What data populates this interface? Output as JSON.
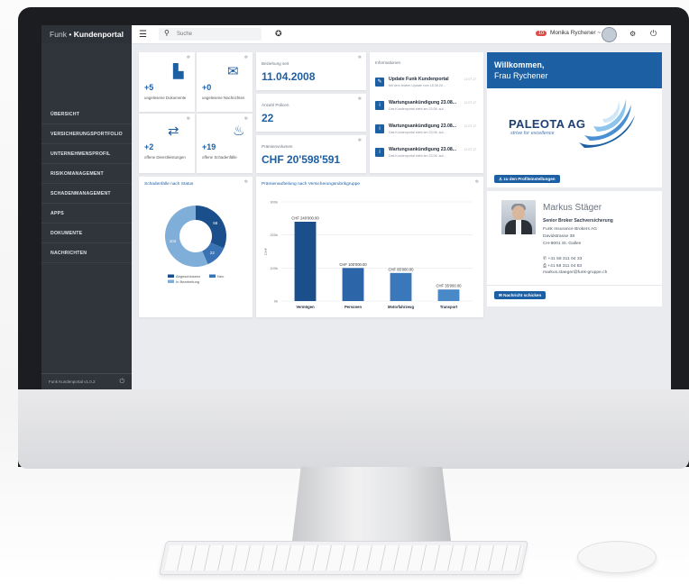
{
  "topbar": {
    "brand_thin": "Funk",
    "brand_sep": "•",
    "brand_bold": "Kundenportal",
    "search_placeholder": "Suche",
    "user_badge": "10",
    "user_name": "Monika Rychener ~"
  },
  "sidebar": {
    "items": [
      {
        "label": "ÜBERSICHT"
      },
      {
        "label": "VERSICHERUNGSPORTFOLIO"
      },
      {
        "label": "UNTERNEHMENSPROFIL"
      },
      {
        "label": "RISIKOMANAGEMENT"
      },
      {
        "label": "SCHADENMANAGEMENT"
      },
      {
        "label": "APPS"
      },
      {
        "label": "DOKUMENTE"
      },
      {
        "label": "NACHRICHTEN"
      }
    ],
    "footer": "Funk Kundenportal v1.0.2"
  },
  "tiles": [
    {
      "value": "+5",
      "label": "ungelesene Dokumente",
      "icon": "document-icon"
    },
    {
      "value": "+0",
      "label": "ungelesene Nachrichten",
      "icon": "envelope-icon"
    },
    {
      "value": "+2",
      "label": "offene Dienstleistungen",
      "icon": "repeat-icon"
    },
    {
      "value": "+19",
      "label": "offene Schadenfälle",
      "icon": "fire-icon"
    }
  ],
  "stats": {
    "relationship_label": "Beziehung seit",
    "relationship_value": "11.04.2008",
    "policies_label": "Anzahl Policen",
    "policies_value": "22",
    "premium_label": "Prämienvolumen",
    "premium_value": "CHF 20'598'591"
  },
  "info": {
    "title": "Informationen",
    "items": [
      {
        "title": "Update Funk Kundenportal",
        "sub": "Mit dem letzten Update vom 18.08.20...",
        "date": "12.07.17",
        "icon": "wrench-icon"
      },
      {
        "title": "Wartungsankündigung 23.08...",
        "sub": "Das Kundenportal steht am 23.08. auf...",
        "date": "12.07.17",
        "icon": "info-icon"
      },
      {
        "title": "Wartungsankündigung 23.08...",
        "sub": "Das Kundenportal steht am 23.08. auf...",
        "date": "12.07.17",
        "icon": "info-icon"
      },
      {
        "title": "Wartungsankündigung 23.08...",
        "sub": "Das Kundenportal steht am 23.08. auf...",
        "date": "12.07.17",
        "icon": "info-icon"
      }
    ]
  },
  "welcome": {
    "line1": "Willkommen,",
    "line2": "Frau Rychener",
    "company_logo": "PALEOTA AG",
    "company_slogan": "strive for excellence",
    "profile_button": "zu den Profileinstellungen"
  },
  "broker": {
    "name": "Markus Stäger",
    "role": "Senior Broker Sachversicherung",
    "company": "Funk Insurance Brokers AG",
    "street": "Davidstrasse 38",
    "city": "CH-9001 St. Gallen",
    "phone": "+41 58 311 04 33",
    "fax": "+41 58 311 04 83",
    "email": "markus.staeger@funk-gruppe.ch",
    "message_button": "Nachricht schicken"
  },
  "chart_data": [
    {
      "type": "pie",
      "title": "Schadenfälle nach Status",
      "categories": [
        "Abgeschlossen",
        "Neu",
        "In Bearbeitung"
      ],
      "values": [
        58,
        22,
        104
      ],
      "slice_labels": [
        "58",
        "22",
        "104"
      ],
      "colors": [
        "#1a4f8b",
        "#3a73b5",
        "#7faed8"
      ],
      "legend_position": "bottom"
    },
    {
      "type": "bar",
      "title": "Prämienaufteilung nach Versicherungsrubrikgruppe",
      "categories": [
        "Vermögen",
        "Personen",
        "Motorfahrzeug",
        "Transport"
      ],
      "values": [
        240000,
        100000,
        85000,
        35000
      ],
      "data_labels": [
        "CHF 240'000.00",
        "CHF 100'000.00",
        "CHF 85'000.00",
        "CHF 35'000.00"
      ],
      "ylabel": "CHF",
      "yticks": [
        "0k",
        "100k",
        "200k",
        "300k"
      ],
      "ylim": [
        0,
        300000
      ],
      "colors": [
        "#1a4f8b",
        "#2d66a8",
        "#3b78bb",
        "#4a89c8"
      ],
      "grid": true
    }
  ]
}
